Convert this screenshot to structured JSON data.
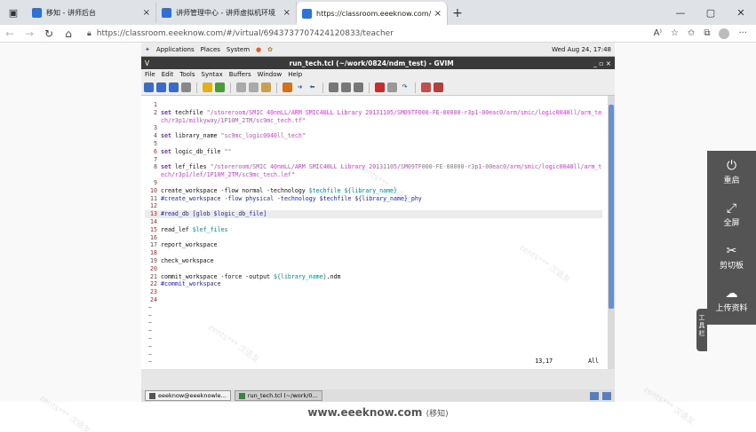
{
  "browser": {
    "tabs": [
      {
        "title": "移知 - 讲师后台",
        "close": "×"
      },
      {
        "title": "讲师管理中心 - 讲师虚拟机环境",
        "close": "×"
      },
      {
        "title": "https://classroom.eeeknow.com/",
        "close": "×"
      }
    ],
    "new_tab": "+",
    "window_controls": {
      "minimize": "—",
      "maximize": "▢",
      "close": "✕"
    },
    "url": "https://classroom.eeeknow.com/#/virtual/6943737707424120833/teacher",
    "more": "···"
  },
  "desktop": {
    "menu": [
      "Applications",
      "Places",
      "System"
    ],
    "datetime": "Wed Aug 24, 17:48"
  },
  "gvim": {
    "title": "run_tech.tcl (~/work/0824/ndm_test) - GVIM",
    "menu": [
      "File",
      "Edit",
      "Tools",
      "Syntax",
      "Buffers",
      "Window",
      "Help"
    ],
    "lines": [
      {
        "n": "1",
        "parts": []
      },
      {
        "n": "2",
        "parts": [
          {
            "t": "set",
            "k": "kw"
          },
          {
            "t": " techfile ",
            "k": ""
          },
          {
            "t": "\"/storeroom/SMIC 40nmLL/ARM SMIC40LL Library 20131105/SM09TF000-FE-00000-r3p1-00eac0/arm/smic/logic0040ll/arm_tech/r3p1/milkyway/1P10M_2TM/sc9mc_tech.tf\"",
            "k": "st"
          }
        ]
      },
      {
        "n": "3",
        "parts": []
      },
      {
        "n": "4",
        "parts": [
          {
            "t": "set",
            "k": "kw"
          },
          {
            "t": " library_name ",
            "k": ""
          },
          {
            "t": "\"sc9mc_logic0040ll_tech\"",
            "k": "st"
          }
        ]
      },
      {
        "n": "5",
        "parts": []
      },
      {
        "n": "6",
        "parts": [
          {
            "t": "set",
            "k": "kw"
          },
          {
            "t": " logic_db_file ",
            "k": ""
          },
          {
            "t": "\"\"",
            "k": "st"
          }
        ]
      },
      {
        "n": "7",
        "parts": []
      },
      {
        "n": "8",
        "parts": [
          {
            "t": "set",
            "k": "kw"
          },
          {
            "t": " lef_files ",
            "k": ""
          },
          {
            "t": "\"/storeroom/SMIC 40nmLL/ARM SMIC40LL Library 20131105/SM09TF000-FE-00000-r3p1-00eac0/arm/smic/logic0040ll/arm_tech/r3p1/lef/1P10M_2TM/sc9mc_tech.lef\"",
            "k": "st"
          }
        ]
      },
      {
        "n": "9",
        "parts": []
      },
      {
        "n": "10",
        "parts": [
          {
            "t": "create_workspace -flow normal -technology ",
            "k": ""
          },
          {
            "t": "$techfile",
            "k": "vr"
          },
          {
            "t": " ",
            "k": ""
          },
          {
            "t": "${library_name}",
            "k": "vr"
          }
        ]
      },
      {
        "n": "11",
        "parts": [
          {
            "t": "#create_workspace -flow physical -technology $techfile ${library_name}_phy",
            "k": "cm"
          }
        ]
      },
      {
        "n": "12",
        "parts": []
      },
      {
        "n": "13",
        "parts": [
          {
            "t": "#read_db [glob $logic_db_file]",
            "k": "cm"
          }
        ],
        "hl": true
      },
      {
        "n": "14",
        "parts": []
      },
      {
        "n": "15",
        "parts": [
          {
            "t": "read_lef ",
            "k": ""
          },
          {
            "t": "$lef_files",
            "k": "vr"
          }
        ]
      },
      {
        "n": "16",
        "parts": []
      },
      {
        "n": "17",
        "parts": [
          {
            "t": "report_workspace",
            "k": ""
          }
        ]
      },
      {
        "n": "18",
        "parts": []
      },
      {
        "n": "19",
        "parts": [
          {
            "t": "check_workspace",
            "k": ""
          }
        ]
      },
      {
        "n": "20",
        "parts": []
      },
      {
        "n": "21",
        "parts": [
          {
            "t": "commit_workspace -force -output ",
            "k": ""
          },
          {
            "t": "${library_name}",
            "k": "vr"
          },
          {
            "t": ".ndm",
            "k": ""
          }
        ]
      },
      {
        "n": "22",
        "parts": [
          {
            "t": "#commit_workspace",
            "k": "cm"
          }
        ]
      },
      {
        "n": "23",
        "parts": []
      },
      {
        "n": "24",
        "parts": []
      }
    ],
    "tilde_count": 8,
    "cursor_pos": "13,17",
    "scroll_pos": "All"
  },
  "taskbar": {
    "items": [
      "eeeknow@eeeknowle...",
      "run_tech.tcl (~/work/0..."
    ]
  },
  "side_panel": {
    "tab_label": "工具栏",
    "items": [
      {
        "icon": "power-icon",
        "label": "重启"
      },
      {
        "icon": "fullscreen-icon",
        "label": "全屏"
      },
      {
        "icon": "scissors-icon",
        "label": "剪切板"
      },
      {
        "icon": "cloud-upload-icon",
        "label": "上传资料"
      }
    ]
  },
  "footer": {
    "site": "www.eeeknow.com",
    "brand": "(移知)"
  },
  "watermark": "zents***  汉语友"
}
